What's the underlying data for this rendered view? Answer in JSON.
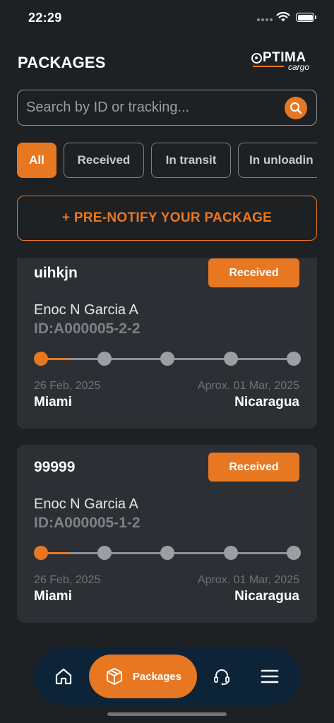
{
  "status_bar": {
    "time": "22:29"
  },
  "header": {
    "title": "PACKAGES",
    "logo_main": "PTIMA",
    "logo_sub": "cargo"
  },
  "search": {
    "placeholder": "Search by ID or tracking..."
  },
  "filters": [
    {
      "label": "All",
      "active": true
    },
    {
      "label": "Received",
      "active": false
    },
    {
      "label": "In transit",
      "active": false
    },
    {
      "label": "In unloadin",
      "active": false
    }
  ],
  "prenotify": {
    "label": "+ PRE-NOTIFY YOUR PACKAGE"
  },
  "packages": [
    {
      "name": "uihkjn",
      "status": "Received",
      "owner": "Enoc N Garcia A",
      "id": "ID:A000005-2-2",
      "progress_step": 1,
      "progress_total": 5,
      "date_from": "26 Feb, 2025",
      "date_to": "Aprox. 01 Mar, 2025",
      "origin": "Miami",
      "destination": "Nicaragua"
    },
    {
      "name": "99999",
      "status": "Received",
      "owner": "Enoc N Garcia A",
      "id": "ID:A000005-1-2",
      "progress_step": 1,
      "progress_total": 5,
      "date_from": "26 Feb, 2025",
      "date_to": "Aprox. 01 Mar, 2025",
      "origin": "Miami",
      "destination": "Nicaragua"
    }
  ],
  "bottom_nav": {
    "items": [
      {
        "icon": "home-icon"
      },
      {
        "icon": "box-icon",
        "label": "Packages",
        "active": true
      },
      {
        "icon": "headset-icon"
      },
      {
        "icon": "menu-icon"
      }
    ]
  },
  "colors": {
    "accent": "#e87722",
    "background": "#1e2124",
    "card": "#2c3034",
    "nav": "#0d2338"
  }
}
